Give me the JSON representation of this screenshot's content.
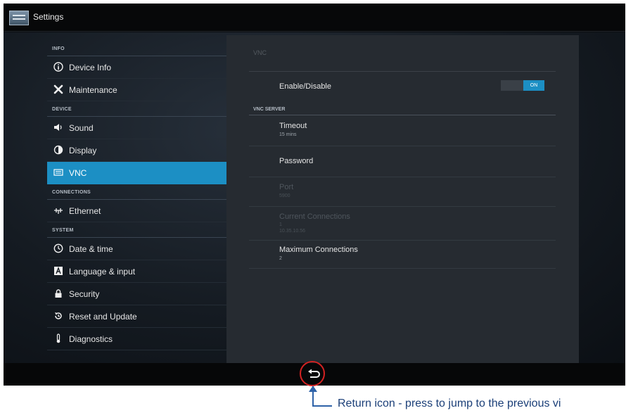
{
  "app": {
    "title": "Settings",
    "icon": "settings-app-icon"
  },
  "sidebar": {
    "sections": [
      {
        "header": "INFO",
        "items": [
          {
            "label": "Device Info",
            "icon": "info-icon"
          },
          {
            "label": "Maintenance",
            "icon": "tools-icon"
          }
        ]
      },
      {
        "header": "DEVICE",
        "items": [
          {
            "label": "Sound",
            "icon": "speaker-icon"
          },
          {
            "label": "Display",
            "icon": "brightness-icon"
          },
          {
            "label": "VNC",
            "icon": "vnc-icon",
            "active": true
          }
        ]
      },
      {
        "header": "CONNECTIONS",
        "items": [
          {
            "label": "Ethernet",
            "icon": "ethernet-icon"
          }
        ]
      },
      {
        "header": "SYSTEM",
        "items": [
          {
            "label": "Date & time",
            "icon": "clock-icon"
          },
          {
            "label": "Language & input",
            "icon": "keyboard-icon"
          },
          {
            "label": "Security",
            "icon": "lock-icon"
          },
          {
            "label": "Reset and Update",
            "icon": "reset-icon"
          },
          {
            "label": "Diagnostics",
            "icon": "thermometer-icon"
          }
        ]
      }
    ]
  },
  "vnc": {
    "title": "VNC",
    "enable_label": "Enable/Disable",
    "toggle_state": "ON",
    "server_header": "VNC SERVER",
    "timeout": {
      "title": "Timeout",
      "value": "15 mins"
    },
    "password": {
      "title": "Password"
    },
    "port": {
      "title": "Port",
      "value": "5900",
      "enabled": false
    },
    "current_connections": {
      "title": "Current Connections",
      "value": "1",
      "detail": "10.35.10.56",
      "enabled": false
    },
    "max_connections": {
      "title": "Maximum Connections",
      "value": "2"
    }
  },
  "navbar": {
    "back_icon": "return-icon"
  },
  "annotation": {
    "text": "Return icon - press to jump to the previous vi"
  },
  "colors": {
    "accent": "#1c8fc4",
    "highlight_circle": "#d42222",
    "callout": "#2e62a8"
  }
}
